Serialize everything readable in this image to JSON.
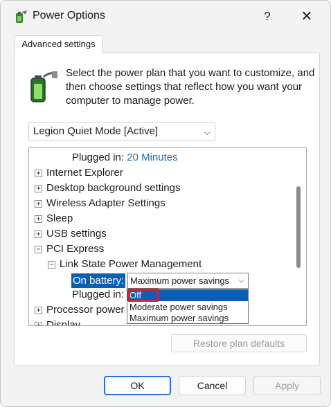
{
  "window": {
    "title": "Power Options",
    "help_glyph": "?",
    "close_glyph": "✕"
  },
  "tab": {
    "label": "Advanced settings"
  },
  "description": "Select the power plan that you want to customize, and then choose settings that reflect how you want your computer to manage power.",
  "plan_select": {
    "value": "Legion Quiet Mode [Active]",
    "chevron": "⌵"
  },
  "tree": {
    "plugged_in_top": {
      "label": "Plugged in:",
      "value": "20 Minutes"
    },
    "items": [
      {
        "label": "Internet Explorer",
        "expander": "+"
      },
      {
        "label": "Desktop background settings",
        "expander": "+"
      },
      {
        "label": "Wireless Adapter Settings",
        "expander": "+"
      },
      {
        "label": "Sleep",
        "expander": "+"
      },
      {
        "label": "USB settings",
        "expander": "+"
      },
      {
        "label": "PCI Express",
        "expander": "−"
      }
    ],
    "link_state": {
      "label": "Link State Power Management",
      "expander": "−"
    },
    "on_battery": {
      "label": "On battery:",
      "value": "Maximum power savings",
      "chevron": "⌵"
    },
    "plugged_in_bottom": {
      "label": "Plugged in:"
    },
    "processor": {
      "label": "Processor power m",
      "expander": "+"
    },
    "display": {
      "label": "Display",
      "expander": "+"
    }
  },
  "dropdown_options": [
    "Off",
    "Moderate power savings",
    "Maximum power savings"
  ],
  "buttons": {
    "restore": "Restore plan defaults",
    "ok": "OK",
    "cancel": "Cancel",
    "apply": "Apply"
  },
  "colors": {
    "selection": "#0a5fb4",
    "highlight_box": "#d32030",
    "link": "#1a6fb5"
  }
}
